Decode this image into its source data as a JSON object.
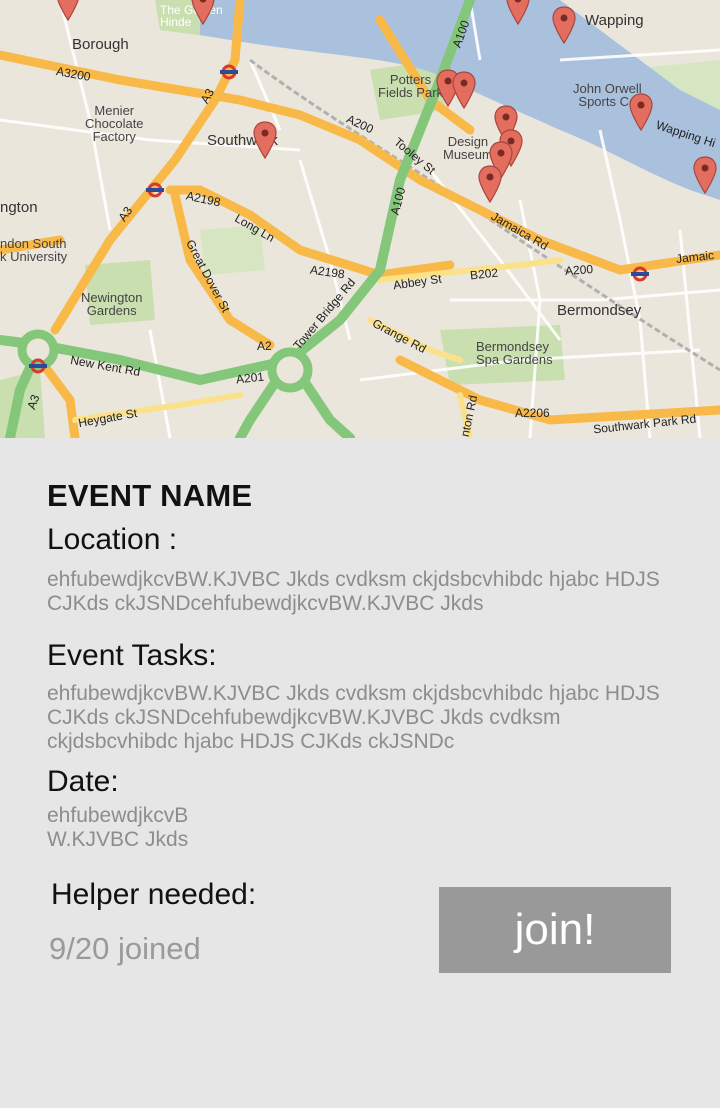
{
  "map": {
    "labels": {
      "borough": "Borough",
      "wapping": "Wapping",
      "potters_fields_park": "Potters\nFields Park",
      "john_orwell": "John Orwell\nSports Ce",
      "menier": "Menier\nChocolate\nFactory",
      "southwark": "Southwark",
      "design_museum": "Design\nMuseum",
      "ngton": "ngton",
      "london_south": "ndon South\nk University",
      "newington_gardens": "Newington\nGardens",
      "bermondsey": "Bermondsey",
      "bermondsey_spa": "Bermondsey\nSpa Gardens",
      "golden_hinde": "The Golden\nHinde",
      "a3200": "A3200",
      "a200_a": "A200",
      "a200_b": "A200",
      "tooley_st": "Tooley St",
      "a2198_a": "A2198",
      "long_ln": "Long Ln",
      "a2198_b": "A2198",
      "abbey_st": "Abbey St",
      "b202": "B202",
      "jamaica_rd": "Jamaica Rd",
      "jamaica_b": "Jamaic",
      "great_dover_st": "Great Dover St",
      "tower_bridge_rd": "Tower Bridge Rd",
      "grange_rd": "Grange Rd",
      "a100_a": "A100",
      "a100_b": "A100",
      "a3_a": "A3",
      "a3_b": "A3",
      "a3_c": "A3",
      "a2_a": "A2",
      "new_kent_rd": "New Kent Rd",
      "a201": "A201",
      "heygate_st": "Heygate St",
      "a2206": "A2206",
      "southwark_park_rd": "Southwark Park Rd",
      "wapping_high": "Wapping Hi",
      "nton_rd": "nton Rd"
    }
  },
  "event": {
    "name": "EVENT NAME",
    "location_label": "Location :",
    "location_text": "ehfubewdjkcvBW.KJVBC Jkds cvdksm ckjdsbcvhibdc hjabc HDJS CJKds ckJSNDcehfubewdjkcvBW.KJVBC Jkds",
    "tasks_label": "Event Tasks:",
    "tasks_text": "ehfubewdjkcvBW.KJVBC Jkds cvdksm ckjdsbcvhibdc hjabc HDJS CJKds ckJSNDcehfubewdjkcvBW.KJVBC Jkds cvdksm ckjdsbcvhibdc hjabc HDJS CJKds ckJSNDc",
    "date_label": "Date:",
    "date_text": "ehfubewdjkcvB\nW.KJVBC Jkds",
    "helper_label": "Helper needed:",
    "joined_text": "9/20 joined",
    "join_button": "join!"
  },
  "colors": {
    "background": "#e6e6e6",
    "button": "#999999",
    "river": "#a9c1dd",
    "major_road": "#f9b949",
    "green_road": "#84c77a",
    "marker": "#e36d5e"
  }
}
